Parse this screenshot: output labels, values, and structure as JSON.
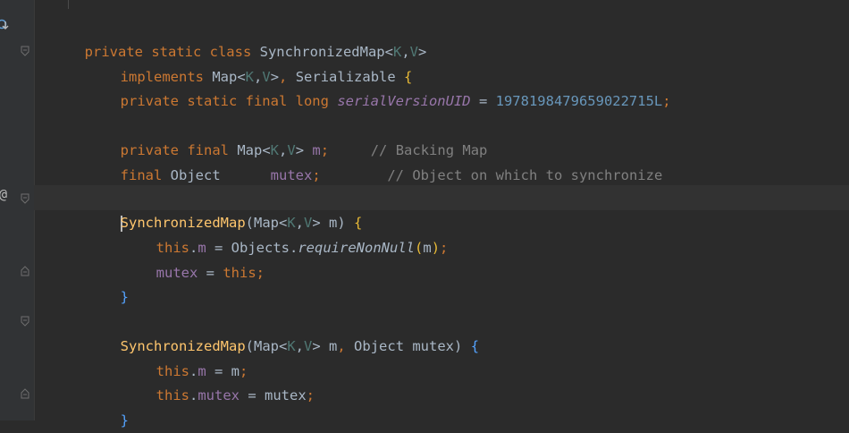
{
  "editor": {
    "lines": [
      "private static class SynchronizedMap<K,V>",
      "implements Map<K,V>, Serializable {",
      "private static final long serialVersionUID = 1978198479659022715L;",
      "private final Map<K,V> m;     // Backing Map",
      "final Object      mutex;        // Object on which to synchronize",
      "SynchronizedMap(Map<K,V> m) {",
      "this.m = Objects.requireNonNull(m);",
      "mutex = this;",
      "}",
      "SynchronizedMap(Map<K,V> m, Object mutex) {",
      "this.m = m;",
      "this.mutex = mutex;",
      "}"
    ],
    "gutter": {
      "override_marker": "@",
      "implementation_icon": "implemented-icon"
    },
    "colors": {
      "background": "#2b2b2b",
      "keyword": "#cc7832",
      "field": "#9876aa",
      "number": "#6897bb",
      "comment": "#808080",
      "method": "#ffc66d",
      "type_param": "#507874"
    }
  }
}
